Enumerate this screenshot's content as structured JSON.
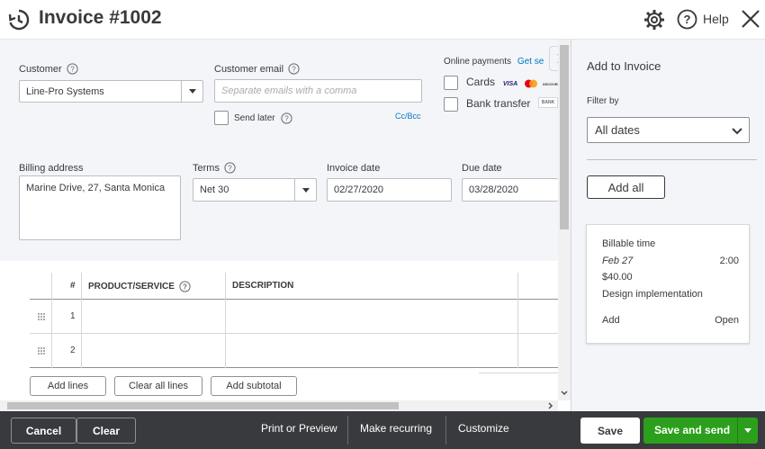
{
  "header": {
    "title": "Invoice #1002",
    "help_label": "Help"
  },
  "customer": {
    "label": "Customer",
    "value": "Line-Pro Systems"
  },
  "customer_email": {
    "label": "Customer email",
    "placeholder": "Separate emails with a comma",
    "send_later_label": "Send later",
    "cc_bcc_label": "Cc/Bcc"
  },
  "online_payments": {
    "label": "Online payments",
    "get_setup_link": "Get se",
    "cards_label": "Cards",
    "card_logos": [
      "VISA",
      "",
      "DISCOVER"
    ],
    "bank_label": "Bank transfer",
    "bank_logo": "BANK"
  },
  "billing": {
    "label": "Billing address",
    "value": "Marine Drive, 27, Santa Monica"
  },
  "terms": {
    "label": "Terms",
    "value": "Net 30"
  },
  "invoice_date": {
    "label": "Invoice date",
    "value": "02/27/2020"
  },
  "due_date": {
    "label": "Due date",
    "value": "03/28/2020"
  },
  "table": {
    "columns": [
      "#",
      "PRODUCT/SERVICE",
      "DESCRIPTION"
    ],
    "rows": [
      {
        "num": "1",
        "product": "",
        "description": ""
      },
      {
        "num": "2",
        "product": "",
        "description": ""
      }
    ],
    "add_lines_label": "Add lines",
    "clear_lines_label": "Clear all lines",
    "add_subtotal_label": "Add subtotal"
  },
  "side_panel": {
    "title": "Add to Invoice",
    "filter_label": "Filter by",
    "filter_value": "All dates",
    "add_all_label": "Add all",
    "card": {
      "title": "Billable time",
      "date": "Feb 27",
      "duration": "2:00",
      "amount": "$40.00",
      "description": "Design implementation",
      "add_label": "Add",
      "open_label": "Open"
    }
  },
  "footer": {
    "cancel_label": "Cancel",
    "clear_label": "Clear",
    "print_label": "Print or Preview",
    "recurring_label": "Make recurring",
    "customize_label": "Customize",
    "save_label": "Save",
    "save_send_label": "Save and send"
  },
  "colors": {
    "accent_green": "#2ca01c",
    "link_blue": "#0077c5",
    "footer_bg": "#393a3d",
    "form_bg": "#f4f5f8"
  }
}
